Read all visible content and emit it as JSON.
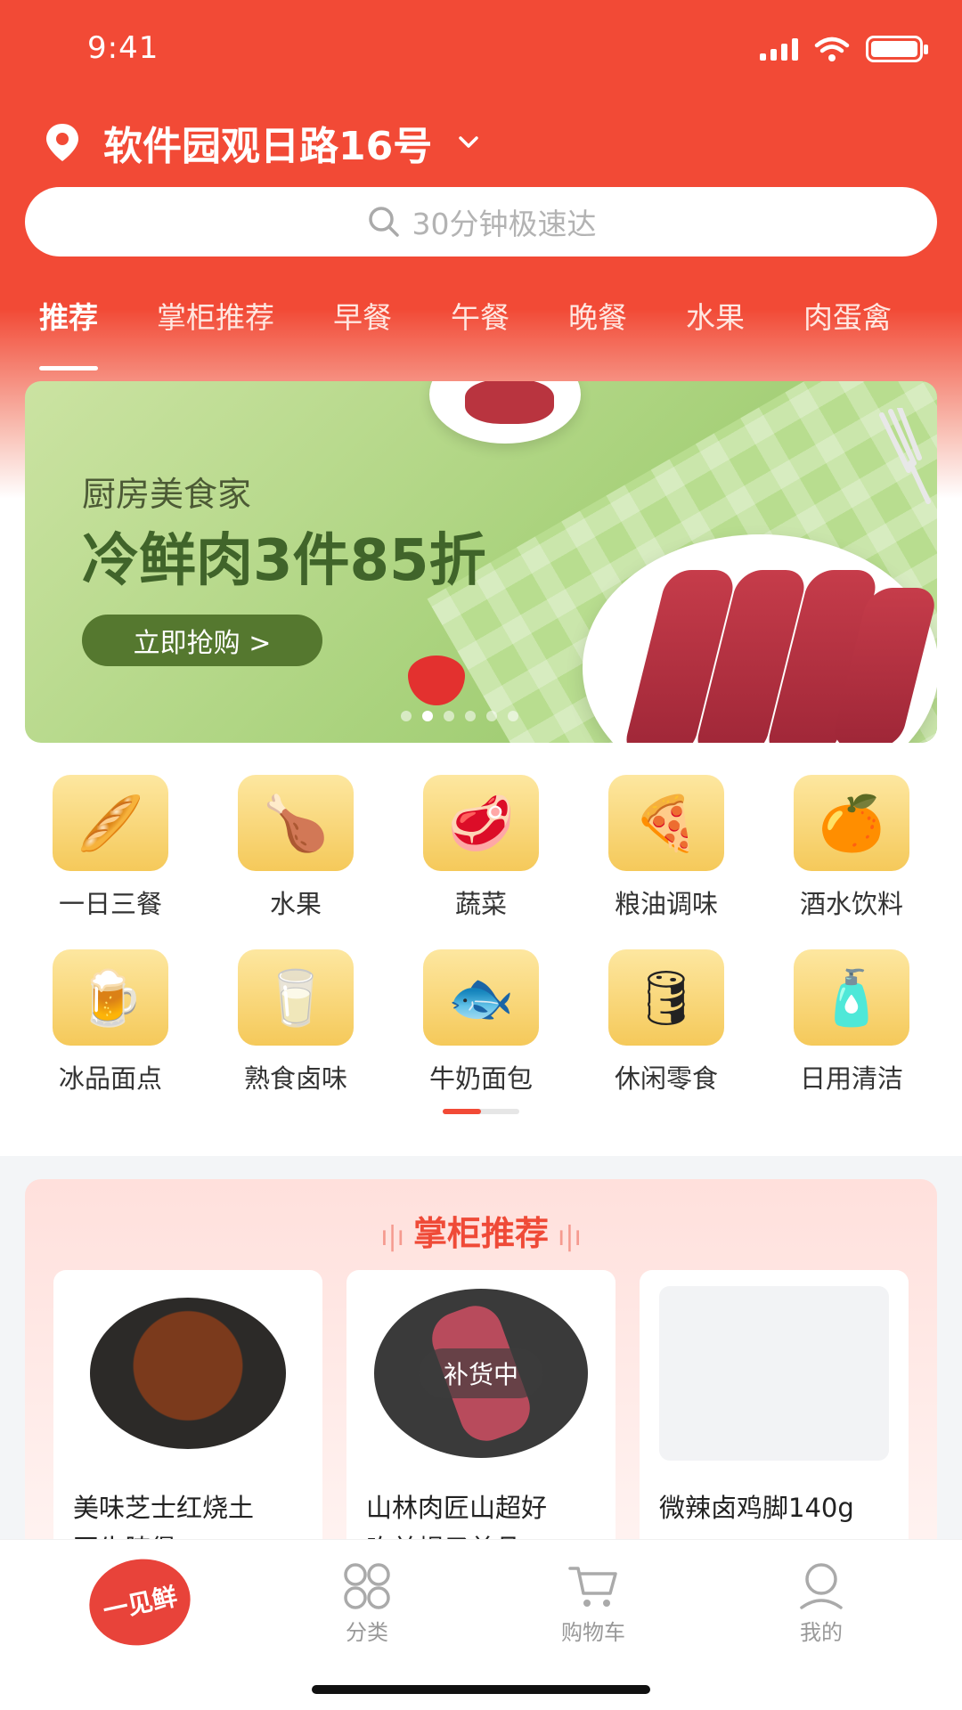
{
  "status": {
    "time": "9:41"
  },
  "header": {
    "address": "软件园观日路16号"
  },
  "search": {
    "placeholder": "30分钟极速达"
  },
  "tabs": [
    "推荐",
    "掌柜推荐",
    "早餐",
    "午餐",
    "晚餐",
    "水果",
    "肉蛋禽"
  ],
  "banner": {
    "subtitle": "厨房美食家",
    "title": "冷鲜肉3件85折",
    "cta": "立即抢购 >",
    "page_count": 6,
    "active_page": 2
  },
  "categories": [
    {
      "label": "一日三餐",
      "icon": "youtiao-icon",
      "glyph": "🥖"
    },
    {
      "label": "水果",
      "icon": "chicken-wings-icon",
      "glyph": "🍗"
    },
    {
      "label": "蔬菜",
      "icon": "steak-plate-icon",
      "glyph": "🥩"
    },
    {
      "label": "粮油调味",
      "icon": "pizza-slice-icon",
      "glyph": "🍕"
    },
    {
      "label": "酒水饮料",
      "icon": "orange-icon",
      "glyph": "🍊"
    },
    {
      "label": "冰品面点",
      "icon": "beer-can-icon",
      "glyph": "🍺"
    },
    {
      "label": "熟食卤味",
      "icon": "milk-bottle-icon",
      "glyph": "🥛"
    },
    {
      "label": "牛奶面包",
      "icon": "fish-icon",
      "glyph": "🐟"
    },
    {
      "label": "休闲零食",
      "icon": "oil-bottle-icon",
      "glyph": "🛢"
    },
    {
      "label": "日用清洁",
      "icon": "detergent-icon",
      "glyph": "🧴"
    }
  ],
  "recommend": {
    "title": "掌柜推荐",
    "products": [
      {
        "name_line1": "美味芝士红烧土",
        "name_line2": "豆牛腩煲",
        "image": "stew"
      },
      {
        "name_line1": "山林肉匠山超好",
        "name_line2": "吃羊蝎子首品",
        "image": "beef",
        "badge": "补货中"
      },
      {
        "name_line1": "微辣卤鸡脚140g",
        "name_line2": "",
        "image": "blank"
      }
    ]
  },
  "tabbar": [
    {
      "label": "一见鲜",
      "icon": "brand-logo-icon"
    },
    {
      "label": "分类",
      "icon": "category-grid-icon"
    },
    {
      "label": "购物车",
      "icon": "cart-icon"
    },
    {
      "label": "我的",
      "icon": "user-icon"
    }
  ],
  "colors": {
    "brand": "#f24a36",
    "banner_green": "#40642a"
  }
}
